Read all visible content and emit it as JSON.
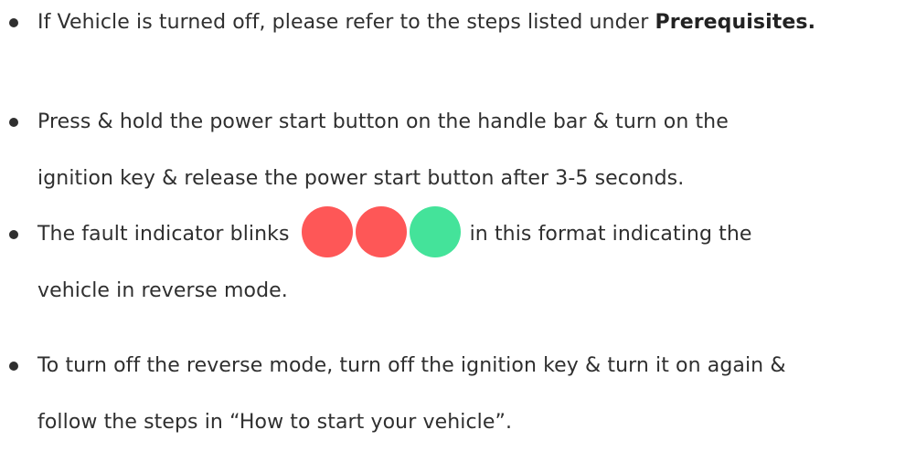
{
  "steps": [
    {
      "before": "If Vehicle is turned off, please refer to the steps listed under ",
      "bold": "Prerequisites."
    },
    {
      "line1": "Press & hold the power start button on the handle bar & turn on the",
      "line2": "ignition key & release the power start button after 3-5 seconds."
    },
    {
      "before": "The fault indicator blinks",
      "after": "in this format indicating the",
      "line2": "vehicle in reverse mode.",
      "indicator_colors": [
        "#fe5757",
        "#fe5757",
        "#44e39a"
      ]
    },
    {
      "line1": "To turn off the reverse mode, turn off the ignition key & turn it on again &",
      "line2": "follow the steps in “How to start your vehicle”."
    }
  ]
}
